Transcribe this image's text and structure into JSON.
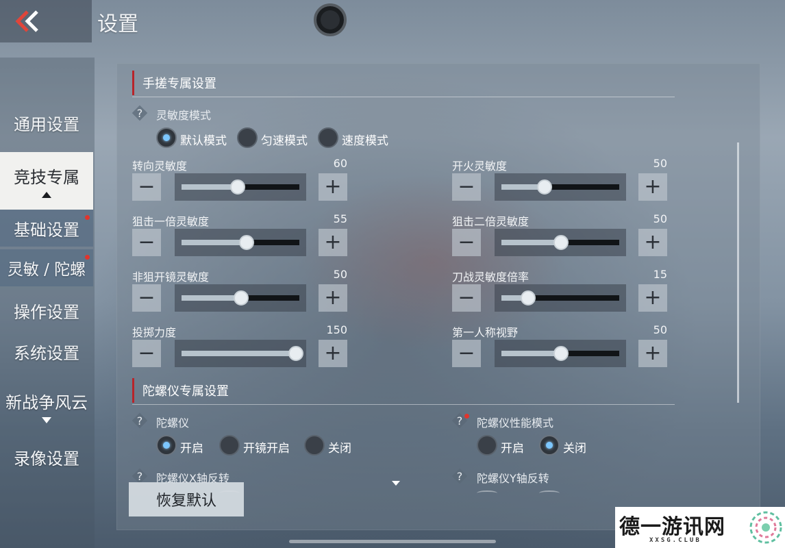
{
  "header": {
    "title": "设置"
  },
  "sidebar": {
    "items": [
      {
        "label": "通用设置"
      },
      {
        "label": "竞技专属"
      },
      {
        "label": "基础设置"
      },
      {
        "label": "灵敏 / 陀螺"
      },
      {
        "label": "操作设置"
      },
      {
        "label": "系统设置"
      },
      {
        "label": "新战争风云"
      },
      {
        "label": "录像设置"
      }
    ]
  },
  "handheld": {
    "title": "手搓专属设置",
    "mode": {
      "label": "灵敏度模式",
      "options": [
        "默认模式",
        "匀速模式",
        "速度模式"
      ],
      "selected": "默认模式"
    },
    "sliders": [
      {
        "label": "转向灵敏度",
        "value": "60",
        "fraction": 0.47
      },
      {
        "label": "开火灵敏度",
        "value": "50",
        "fraction": 0.35
      },
      {
        "label": "狙击一倍灵敏度",
        "value": "55",
        "fraction": 0.55
      },
      {
        "label": "狙击二倍灵敏度",
        "value": "50",
        "fraction": 0.5
      },
      {
        "label": "非狙开镜灵敏度",
        "value": "50",
        "fraction": 0.5
      },
      {
        "label": "刀战灵敏度倍率",
        "value": "15",
        "fraction": 0.2
      },
      {
        "label": "投掷力度",
        "value": "150",
        "fraction": 1.0
      },
      {
        "label": "第一人称视野",
        "value": "50",
        "fraction": 0.5
      }
    ]
  },
  "gyro": {
    "title": "陀螺仪专属设置",
    "gyro": {
      "label": "陀螺仪",
      "options": [
        "开启",
        "开镜开启",
        "关闭"
      ],
      "selected": "开启"
    },
    "perf": {
      "label": "陀螺仪性能模式",
      "options": [
        "开启",
        "关闭"
      ],
      "selected": "关闭"
    },
    "x_invert": {
      "label": "陀螺仪X轴反转"
    },
    "y_invert": {
      "label": "陀螺仪Y轴反转"
    }
  },
  "buttons": {
    "restore": "恢复默认",
    "minus": "−",
    "plus": "+"
  },
  "watermark": {
    "name": "德一游讯网",
    "domain": "XXSG.CLUB"
  },
  "colors": {
    "accent_red": "#b8242a",
    "radio_on": "#7cc7ff",
    "active_tab": "#f1f1ef"
  }
}
